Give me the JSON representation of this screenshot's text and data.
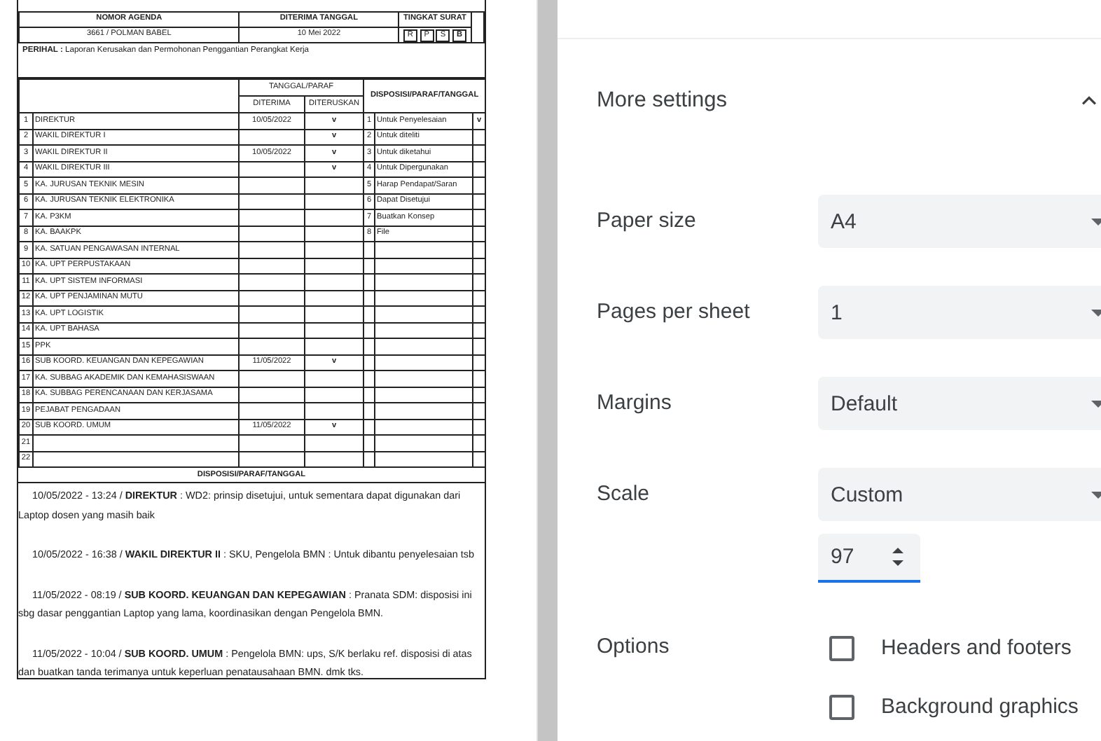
{
  "document": {
    "header": {
      "agenda_label": "NOMOR AGENDA",
      "agenda_value": "3661 / POLMAN BABEL",
      "received_label": "DITERIMA TANGGAL",
      "received_value": "10 Mei 2022",
      "level_label": "TINGKAT SURAT",
      "levels": [
        {
          "label": "R",
          "selected": false
        },
        {
          "label": "P",
          "selected": false
        },
        {
          "label": "S",
          "selected": false
        },
        {
          "label": "B",
          "selected": true
        }
      ]
    },
    "subject_label": "PERIHAL :",
    "subject": "Laporan Kerusakan dan Permohonan Penggantian Perangkat Kerja",
    "columns": {
      "date_group": "TANGGAL/PARAF",
      "received": "DITERIMA",
      "forwarded": "DITERUSKAN",
      "disposition": "DISPOSISI/PARAF/TANGGAL"
    },
    "rows": [
      {
        "number": "1",
        "name": "DIREKTUR",
        "received": "10/05/2022",
        "forwarded": "v",
        "disposition_number": "1",
        "disposition": "Untuk Penyelesaian",
        "disposition_mark": "v"
      },
      {
        "number": "2",
        "name": "WAKIL DIREKTUR I",
        "forwarded": "v",
        "disposition_number": "2",
        "disposition": "Untuk diteliti"
      },
      {
        "number": "3",
        "name": "WAKIL DIREKTUR II",
        "received": "10/05/2022",
        "forwarded": "v",
        "disposition_number": "3",
        "disposition": "Untuk diketahui"
      },
      {
        "number": "4",
        "name": "WAKIL DIREKTUR III",
        "forwarded": "v",
        "disposition_number": "4",
        "disposition": "Untuk Dipergunakan"
      },
      {
        "number": "5",
        "name": "KA. JURUSAN TEKNIK MESIN",
        "disposition_number": "5",
        "disposition": "Harap Pendapat/Saran"
      },
      {
        "number": "6",
        "name": "KA. JURUSAN TEKNIK ELEKTRONIKA",
        "disposition_number": "6",
        "disposition": "Dapat Disetujui"
      },
      {
        "number": "7",
        "name": "KA. P3KM",
        "disposition_number": "7",
        "disposition": "Buatkan Konsep"
      },
      {
        "number": "8",
        "name": "KA. BAAKPK",
        "disposition_number": "8",
        "disposition": "File"
      },
      {
        "number": "9",
        "name": "KA. SATUAN PENGAWASAN INTERNAL"
      },
      {
        "number": "10",
        "name": "KA. UPT PERPUSTAKAAN"
      },
      {
        "number": "11",
        "name": "KA. UPT SISTEM INFORMASI"
      },
      {
        "number": "12",
        "name": "KA. UPT PENJAMINAN MUTU"
      },
      {
        "number": "13",
        "name": "KA. UPT LOGISTIK"
      },
      {
        "number": "14",
        "name": "KA. UPT BAHASA"
      },
      {
        "number": "15",
        "name": "PPK"
      },
      {
        "number": "16",
        "name": "SUB KOORD. KEUANGAN DAN KEPEGAWIAN",
        "received": "11/05/2022",
        "forwarded": "v"
      },
      {
        "number": "17",
        "name": "KA. SUBBAG AKADEMIK DAN KEMAHASISWAAN"
      },
      {
        "number": "18",
        "name": "KA. SUBBAG PERENCANAAN DAN KERJASAMA"
      },
      {
        "number": "19",
        "name": "PEJABAT PENGADAAN"
      },
      {
        "number": "20",
        "name": "SUB KOORD. UMUM",
        "received": "11/05/2022",
        "forwarded": "v"
      },
      {
        "number": "21"
      },
      {
        "number": "22"
      }
    ],
    "notes_title": "DISPOSISI/PARAF/TANGGAL",
    "notes": [
      "10/05/2022 - 13:24 /  **DIREKTUR** : WD2: prinsip disetujui, untuk sementara dapat digunakan dari Laptop dosen yang masih baik",
      "10/05/2022 - 16:38 /  **WAKIL DIREKTUR II** : SKU, Pengelola BMN : Untuk dibantu penyelesaian tsb",
      "11/05/2022 - 08:19 /  **SUB KOORD. KEUANGAN DAN KEPEGAWIAN** : Pranata SDM: disposisi ini sbg dasar penggantian Laptop yang lama, koordinasikan dengan Pengelola BMN.",
      "11/05/2022 - 10:04 /  **SUB KOORD. UMUM** : Pengelola BMN: ups, S/K berlaku ref. disposisi di atas dan buatkan tanda terimanya untuk keperluan penatausahaan BMN. dmk tks."
    ]
  },
  "more_settings": {
    "label": "More settings",
    "expanded": true
  },
  "settings": [
    {
      "kind": "select",
      "label": "Paper size",
      "value": "A4"
    },
    {
      "kind": "select",
      "label": "Pages per sheet",
      "value": "1"
    },
    {
      "kind": "select",
      "label": "Margins",
      "value": "Default"
    },
    {
      "kind": "select",
      "label": "Scale",
      "value": "Custom",
      "input": "97"
    },
    {
      "kind": "checkboxes",
      "label": "Options",
      "items": [
        {
          "label": "Headers and footers",
          "checked": false
        },
        {
          "label": "Background graphics",
          "checked": false
        }
      ]
    }
  ]
}
